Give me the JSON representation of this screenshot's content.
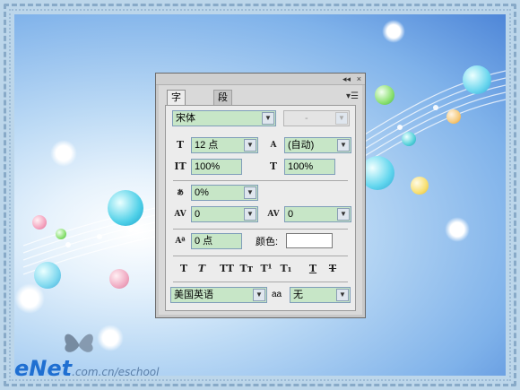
{
  "tabs": {
    "character": "字符",
    "character_close": "×",
    "paragraph": "段落"
  },
  "font": {
    "family": "宋体",
    "style": "-"
  },
  "size": {
    "font_size": "12 点",
    "leading": "(自动)"
  },
  "scale": {
    "vertical": "100%",
    "horizontal": "100%"
  },
  "tsume": "0%",
  "kerning": "0",
  "tracking": "0",
  "baseline_shift": "0 点",
  "color_label": "颜色:",
  "styles": [
    "T",
    "T",
    "TT",
    "Tт",
    "T¹",
    "T₁",
    "T",
    "T"
  ],
  "language": "美国英语",
  "aa_label": "aa",
  "antialias": "无",
  "watermark": {
    "brand": "eNet",
    "url": ".com.cn/eschool"
  },
  "colors": {
    "field_bg": "#c7e6c7",
    "panel_bg": "#d9d9d9",
    "watermark_blue": "#1f6fd1"
  }
}
